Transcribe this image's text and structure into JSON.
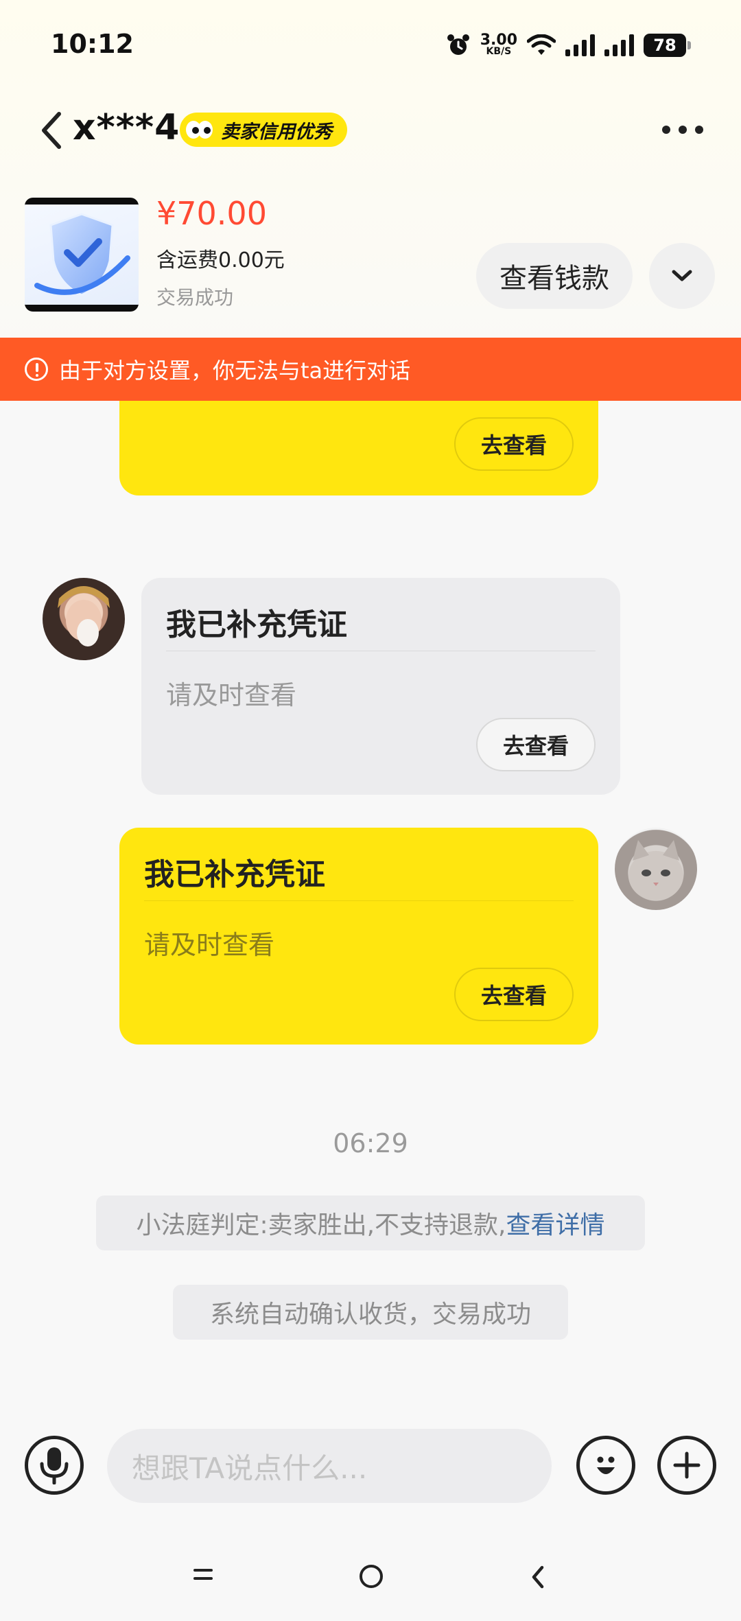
{
  "status_bar": {
    "time": "10:12",
    "net_speed": "3.00",
    "net_unit": "KB/S",
    "battery": "78"
  },
  "header": {
    "nickname": "x***4",
    "badge": "卖家信用优秀"
  },
  "product": {
    "price": "¥70.00",
    "shipping": "含运费0.00元",
    "status": "交易成功",
    "check_money_label": "查看钱款"
  },
  "warning": {
    "text": "由于对方设置，你无法与ta进行对话"
  },
  "messages": [
    {
      "side": "right",
      "view_label": "去查看"
    },
    {
      "side": "left",
      "title": "我已补充凭证",
      "subtitle": "请及时查看",
      "view_label": "去查看"
    },
    {
      "side": "right",
      "title": "我已补充凭证",
      "subtitle": "请及时查看",
      "view_label": "去查看"
    }
  ],
  "timestamp": "06:29",
  "system_messages": [
    {
      "text": "小法庭判定:卖家胜出,不支持退款,",
      "link": "查看详情"
    },
    {
      "text": "系统自动确认收货，交易成功"
    }
  ],
  "input": {
    "placeholder": "想跟TA说点什么..."
  },
  "colors": {
    "brand_yellow": "#ffe60f",
    "price_red": "#ff4a33",
    "warning_orange": "#ff5a25",
    "link_blue": "#3f6ea7"
  },
  "icons": {
    "back": "back-icon",
    "more": "more-icon",
    "expand": "chevron-down-icon",
    "mic": "microphone-icon",
    "emoji": "emoji-icon",
    "plus": "plus-icon"
  }
}
